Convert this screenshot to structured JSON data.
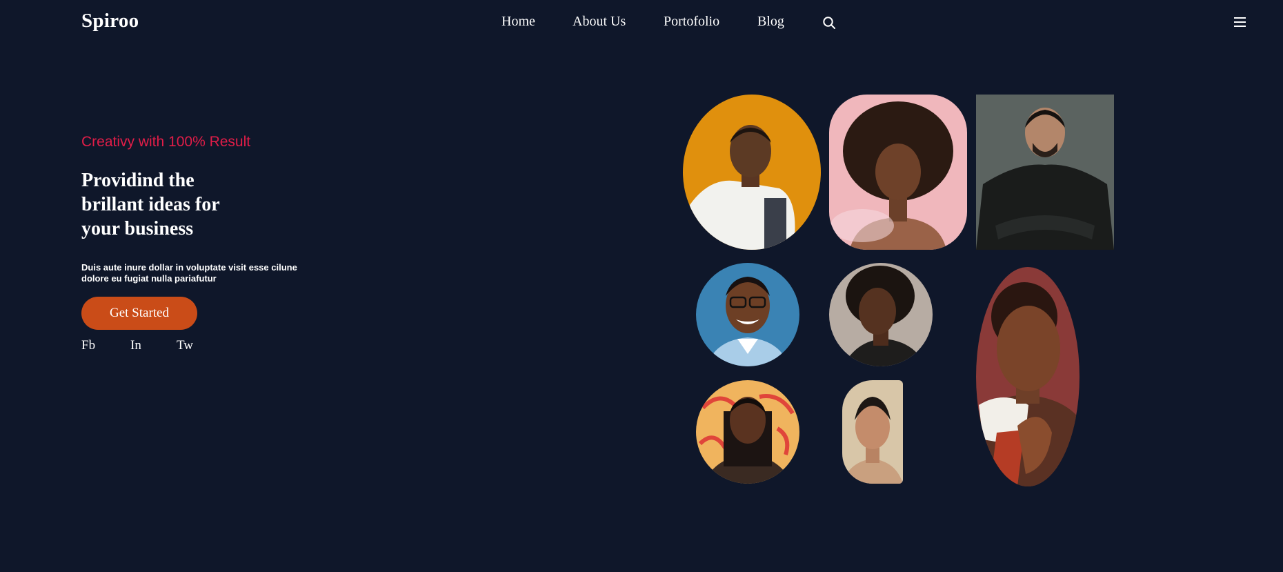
{
  "brand": {
    "name": "Spiroo"
  },
  "nav": {
    "items": [
      {
        "label": "Home"
      },
      {
        "label": "About Us"
      },
      {
        "label": "Portofolio"
      },
      {
        "label": "Blog"
      }
    ],
    "search_icon": "search-icon",
    "menu_icon": "hamburger-menu-icon"
  },
  "hero": {
    "tagline": "Creativy with 100% Result",
    "headline": "Providind the brillant ideas for your business",
    "description": "Duis aute inure dollar in voluptate visit esse cilune dolore eu fugiat nulla pariafutur",
    "cta_label": "Get Started"
  },
  "social": [
    {
      "label": "Fb"
    },
    {
      "label": "In"
    },
    {
      "label": "Tw"
    }
  ],
  "colors": {
    "background": "#0f172a",
    "accent": "#e11d48",
    "cta": "#ca4c18",
    "text": "#ffffff"
  }
}
